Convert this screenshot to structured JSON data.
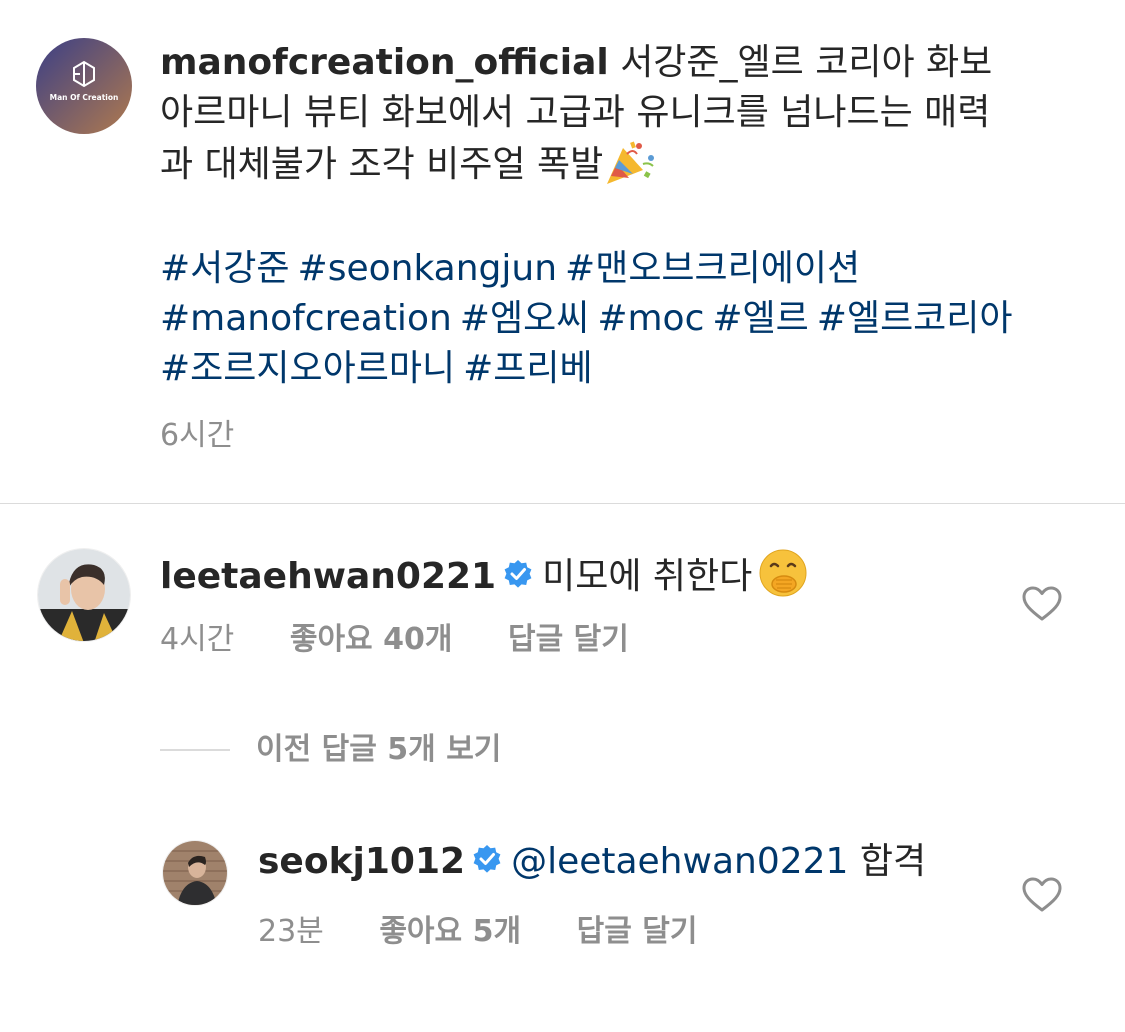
{
  "post": {
    "username": "manofcreation_official",
    "caption_lines": [
      "서강준_엘르 코리아 화보",
      "아르마니 뷰티 화보에서 고급과 유니크를 넘나드는 매력",
      "과 대체불가 조각 비주얼 폭발"
    ],
    "hashtags": [
      "#서강준",
      "#seonkangjun",
      "#맨오브크리에이션",
      "#manofcreation",
      "#엠오씨",
      "#moc",
      "#엘르",
      "#엘르코리아",
      "#조르지오아르마니",
      "#프리베"
    ],
    "time": "6시간",
    "avatar_logo_text": "Man Of Creation",
    "avatar_colors": [
      "#3b3f86",
      "#b07a4e"
    ]
  },
  "comment": {
    "username": "leetaehwan0221",
    "verified": true,
    "text": "미모에 취한다",
    "emoji": "🤭",
    "time": "4시간",
    "likes": "좋아요 40개",
    "reply": "답글 달기"
  },
  "view_replies": "이전 답글 5개 보기",
  "reply": {
    "username": "seokj1012",
    "verified": true,
    "mention": "@leetaehwan0221",
    "text": "합격",
    "time": "23분",
    "likes": "좋아요 5개",
    "reply": "답글 달기"
  },
  "colors": {
    "link_blue": "#00376b",
    "muted": "#8e8e8e",
    "verified_blue": "#3897f0"
  },
  "icons": {
    "party": "party-popper-icon",
    "heart": "heart-outline-icon",
    "verified": "verified-badge-icon"
  }
}
